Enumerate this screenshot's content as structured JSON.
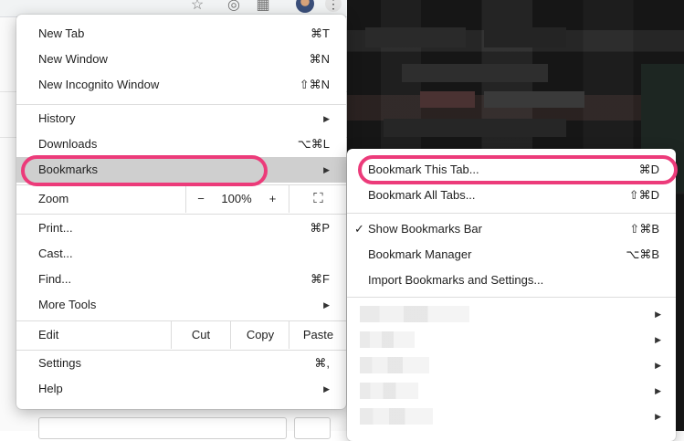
{
  "main_menu": {
    "items": [
      {
        "label": "New Tab",
        "shortcut": "⌘T"
      },
      {
        "label": "New Window",
        "shortcut": "⌘N"
      },
      {
        "label": "New Incognito Window",
        "shortcut": "⇧⌘N"
      },
      {
        "label": "History"
      },
      {
        "label": "Downloads",
        "shortcut": "⌥⌘L"
      },
      {
        "label": "Bookmarks"
      },
      {
        "label": "Print...",
        "shortcut": "⌘P"
      },
      {
        "label": "Cast..."
      },
      {
        "label": "Find...",
        "shortcut": "⌘F"
      },
      {
        "label": "More Tools"
      },
      {
        "label": "Settings",
        "shortcut": "⌘,"
      },
      {
        "label": "Help"
      }
    ],
    "zoom": {
      "label": "Zoom",
      "minus": "−",
      "value": "100%",
      "plus": "+",
      "fullscreen": "⛶"
    },
    "edit": {
      "label": "Edit",
      "cut": "Cut",
      "copy": "Copy",
      "paste": "Paste"
    }
  },
  "bookmarks_menu": {
    "items": [
      {
        "label": "Bookmark This Tab...",
        "shortcut": "⌘D"
      },
      {
        "label": "Bookmark All Tabs...",
        "shortcut": "⇧⌘D"
      },
      {
        "label": "Show Bookmarks Bar",
        "shortcut": "⇧⌘B",
        "check": "✓"
      },
      {
        "label": "Bookmark Manager",
        "shortcut": "⌥⌘B"
      },
      {
        "label": "Import Bookmarks and Settings..."
      }
    ]
  },
  "icons": {
    "star": "☆",
    "kebab": "⋮",
    "submenu_arrow": "▶"
  },
  "colors": {
    "highlight_outline": "#ec3b7a",
    "hover_bg": "#cfcfcf"
  }
}
